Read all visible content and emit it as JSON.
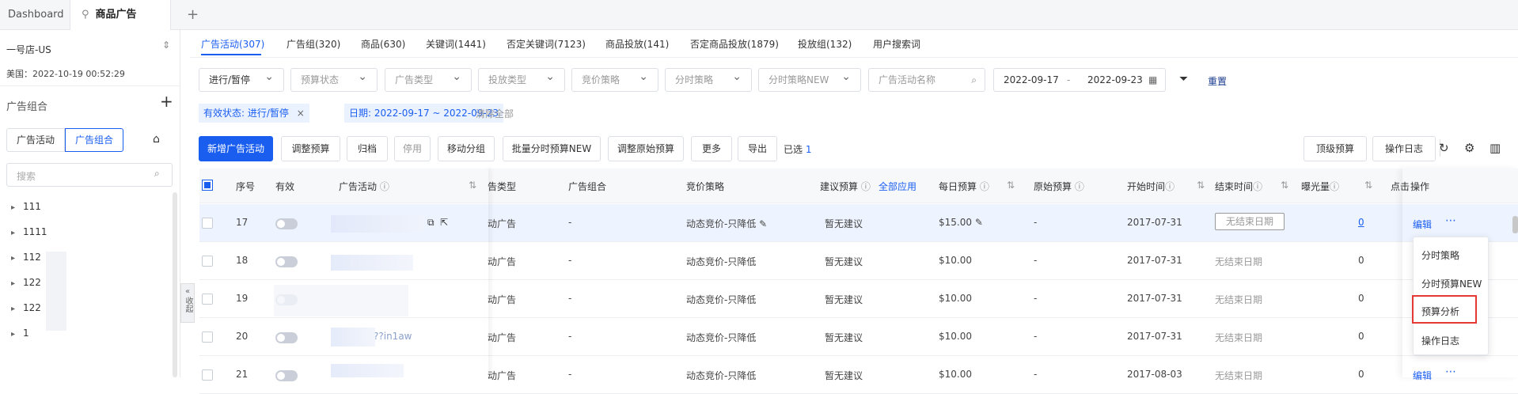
{
  "tabs": {
    "dashboard": "Dashboard",
    "active": "商品广告",
    "add": "+"
  },
  "sidebar": {
    "store": "一号店-US",
    "time": "美国：2022-10-19 00:52:29",
    "group_title": "广告组合",
    "add": "+",
    "seg": [
      "广告活动",
      "广告组合"
    ],
    "search_placeholder": "搜索",
    "items": [
      "111",
      "1111",
      "112",
      "122",
      "122",
      "1"
    ],
    "collapse": "收起"
  },
  "content_tabs": [
    "广告活动(307)",
    "广告组(320)",
    "商品(630)",
    "关键词(1441)",
    "否定关键词(7123)",
    "商品投放(141)",
    "否定商品投放(1879)",
    "投放组(132)",
    "用户搜索词"
  ],
  "filters": {
    "status": "进行/暂停",
    "budget_status": "预算状态",
    "ad_type": "广告类型",
    "target_type": "投放类型",
    "bid_strategy": "竞价策略",
    "time_strategy": "分时策略",
    "time_strategy_new": "分时策略NEW",
    "name_placeholder": "广告活动名称",
    "date_from": "2022-09-17",
    "date_sep": "-",
    "date_to": "2022-09-23",
    "reset": "重置"
  },
  "chips": {
    "status": "有效状态: 进行/暂停",
    "date": "日期: 2022-09-17 ~ 2022-09-23",
    "clear": "清除全部"
  },
  "toolbar": {
    "new": "新增广告活动",
    "adjust": "调整预算",
    "archive": "归档",
    "disable": "停用",
    "move": "移动分组",
    "batch": "批量分时预算NEW",
    "adjust_orig": "调整原始预算",
    "more": "更多",
    "export": "导出",
    "selected": "已选",
    "selected_count": "1",
    "top_budget": "顶级预算",
    "log": "操作日志"
  },
  "columns": {
    "seq": "序号",
    "valid": "有效",
    "campaign": "广告活动",
    "type": "告类型",
    "group": "广告组合",
    "bid": "竞价策略",
    "suggest": "建议预算",
    "apply_all": "全部应用",
    "daily": "每日预算",
    "orig": "原始预算",
    "start": "开始时间",
    "end": "结束时间",
    "imp": "曝光量",
    "clicks": "点击",
    "ops": "操作"
  },
  "rows": [
    {
      "seq": "17",
      "type": "动广告",
      "group": "-",
      "bid": "动态竞价-只降低",
      "suggest": "暂无建议",
      "daily": "$15.00",
      "orig": "-",
      "start": "2017-07-31",
      "end": "无结束日期",
      "imp": "0",
      "op": "编辑"
    },
    {
      "seq": "18",
      "type": "动广告",
      "group": "-",
      "bid": "动态竞价-只降低",
      "suggest": "暂无建议",
      "daily": "$10.00",
      "orig": "-",
      "start": "2017-07-31",
      "end": "无结束日期",
      "imp": "0"
    },
    {
      "seq": "19",
      "type": "动广告",
      "group": "-",
      "bid": "动态竞价-只降低",
      "suggest": "暂无建议",
      "daily": "$10.00",
      "orig": "-",
      "start": "2017-07-31",
      "end": "无结束日期",
      "imp": "0"
    },
    {
      "seq": "20",
      "type": "动广告",
      "group": "-",
      "bid": "动态竞价-只降低",
      "suggest": "暂无建议",
      "daily": "$10.00",
      "orig": "-",
      "start": "2017-07-31",
      "end": "无结束日期",
      "imp": "0",
      "name_frag": "??in1aw"
    },
    {
      "seq": "21",
      "type": "动广告",
      "group": "-",
      "bid": "动态竞价-只降低",
      "suggest": "暂无建议",
      "daily": "$10.00",
      "orig": "-",
      "start": "2017-08-03",
      "end": "无结束日期",
      "imp": "0",
      "op": "编辑"
    }
  ],
  "dropdown": [
    "分时策略",
    "分时预算NEW",
    "预算分析",
    "操作日志"
  ],
  "colors": {
    "primary": "#1a5ef0",
    "highlight": "#e53935"
  }
}
